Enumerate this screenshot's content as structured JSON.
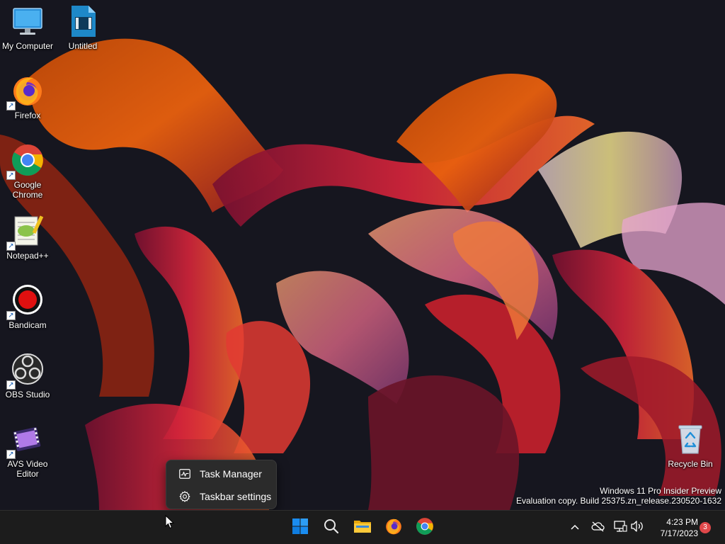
{
  "desktop_icons": [
    {
      "label": "My Computer",
      "icon": "monitor-icon",
      "shortcut": false
    },
    {
      "label": "Untitled",
      "icon": "video-file-icon",
      "shortcut": false
    },
    {
      "label": "Firefox",
      "icon": "firefox-icon",
      "shortcut": true
    },
    {
      "label": "Google Chrome",
      "icon": "chrome-icon",
      "shortcut": true
    },
    {
      "label": "Notepad++",
      "icon": "notepadpp-icon",
      "shortcut": true
    },
    {
      "label": "Bandicam",
      "icon": "bandicam-icon",
      "shortcut": true
    },
    {
      "label": "OBS Studio",
      "icon": "obs-icon",
      "shortcut": true
    },
    {
      "label": "AVS Video Editor",
      "icon": "avs-icon",
      "shortcut": true
    },
    {
      "label": "Recycle Bin",
      "icon": "recycle-bin-icon",
      "shortcut": false
    }
  ],
  "shortcut_glyph": "↗",
  "watermark": {
    "line1": "Windows 11 Pro Insider Preview",
    "line2": "Evaluation copy. Build 25375.zn_release.230520-1632"
  },
  "context_menu": {
    "items": [
      {
        "label": "Task Manager",
        "icon": "task-manager-icon"
      },
      {
        "label": "Taskbar settings",
        "icon": "gear-icon"
      }
    ]
  },
  "taskbar": {
    "pinned": [
      {
        "name": "Start",
        "icon": "windows-start-icon"
      },
      {
        "name": "Search",
        "icon": "search-icon"
      },
      {
        "name": "File Explorer",
        "icon": "folder-icon"
      },
      {
        "name": "Firefox",
        "icon": "firefox-icon"
      },
      {
        "name": "Google Chrome",
        "icon": "chrome-icon"
      }
    ],
    "tray": {
      "icons": [
        "chevron-up-icon",
        "onedrive-offline-icon",
        "network-icon",
        "volume-icon"
      ],
      "time": "4:23 PM",
      "date": "7/17/2023",
      "notification_count": "3"
    }
  },
  "colors": {
    "taskbar_bg": "#1c1c1c",
    "menu_bg": "#2b2b2b",
    "start_blue": "#0f7de0",
    "badge": "#e0484a"
  }
}
